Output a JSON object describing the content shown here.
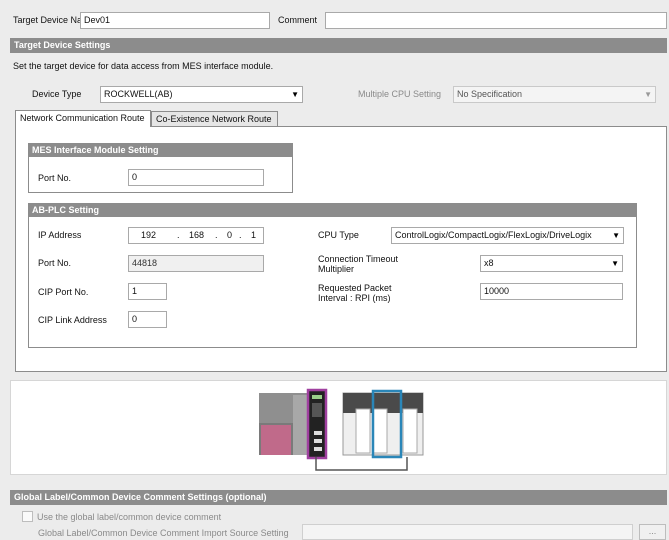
{
  "header": {
    "target_device_name_label": "Target Device Name",
    "target_device_name_value": "Dev01",
    "comment_label": "Comment",
    "comment_value": ""
  },
  "target_device_settings": {
    "title": "Target Device Settings",
    "description": "Set the target device for data access from MES interface module.",
    "device_type_label": "Device Type",
    "device_type_value": "ROCKWELL(AB)",
    "multiple_cpu_label": "Multiple CPU Setting",
    "multiple_cpu_value": "No Specification"
  },
  "tabs": [
    {
      "label": "Network Communication Route",
      "active": true
    },
    {
      "label": "Co-Existence Network Route",
      "active": false
    }
  ],
  "mes_interface": {
    "title": "MES Interface Module Setting",
    "port_label": "Port No.",
    "port_value": "0"
  },
  "ab_plc": {
    "title": "AB-PLC Setting",
    "ip_label": "IP Address",
    "ip_octets": [
      "192",
      "168",
      "0",
      "1"
    ],
    "ip_dot": ".",
    "port_label": "Port No.",
    "port_value": "44818",
    "cip_port_label": "CIP Port No.",
    "cip_port_value": "1",
    "cip_link_label": "CIP Link Address",
    "cip_link_value": "0",
    "cpu_type_label": "CPU Type",
    "cpu_type_value": "ControlLogix/CompactLogix/FlexLogix/DriveLogix",
    "timeout_label_line1": "Connection Timeout",
    "timeout_label_line2": "Multiplier",
    "timeout_value": "x8",
    "rpi_label_line1": "Requested Packet",
    "rpi_label_line2": "Interval : RPI (ms)",
    "rpi_value": "10000"
  },
  "global_label": {
    "title": "Global Label/Common Device Comment Settings (optional)",
    "checkbox_label": "Use the global label/common device comment",
    "import_label": "Global Label/Common Device Comment Import Source Setting",
    "import_value": "",
    "browse_label": "..."
  },
  "colors": {
    "band": "#8c8c8c",
    "mes_highlight": "#a040a0",
    "plc_highlight": "#2a86b8",
    "module_pink": "#c06a8a"
  }
}
